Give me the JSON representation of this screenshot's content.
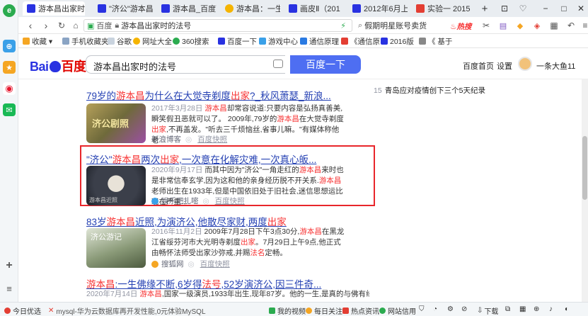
{
  "colors": {
    "accent": "#4e6ef2",
    "link": "#2440b3",
    "highlight": "#f73131",
    "frame": "#e8262b"
  },
  "tabs": [
    {
      "label": "游本昌出家时",
      "active": true
    },
    {
      "label": "\"济公\"游本昌"
    },
    {
      "label": "游本昌_百度百"
    },
    {
      "label": "游本昌：一生"
    },
    {
      "label": "画皮Ⅱ（201"
    },
    {
      "label": "2012年6月上"
    },
    {
      "label": "实验一 2015"
    }
  ],
  "window": {
    "new_tab": "+",
    "minimize": "−",
    "maximize": "□",
    "close": "✕"
  },
  "address": {
    "secure_label": "百度",
    "url": "游本昌出家时的法号",
    "search_hint": "假期明星账号卖货",
    "hot_tag": "热搜"
  },
  "bookmarks": [
    {
      "label": "收藏 ▾"
    },
    {
      "label": "手机收藏夹"
    },
    {
      "label": "谷歌"
    },
    {
      "label": "网址大全"
    },
    {
      "label": "360搜索"
    },
    {
      "label": "百度一下"
    },
    {
      "label": "游戏中心"
    },
    {
      "label": "通信原理"
    },
    {
      "label": "《通信原"
    },
    {
      "label": "2016版"
    },
    {
      "label": "《 基于"
    }
  ],
  "baidu": {
    "logo_left": "Bai",
    "logo_right": "百度",
    "query": "游本昌出家时的法号",
    "search_button": "百度一下",
    "links": [
      "百度首页",
      "设置"
    ],
    "username": "一条大鱼11"
  },
  "results": [
    {
      "title_parts": [
        [
          "79岁的",
          ""
        ],
        [
          "游本昌",
          "hl"
        ],
        [
          "为什么在大觉寺剃度",
          ""
        ],
        [
          "出家",
          "hl"
        ],
        [
          "?_秋风萧瑟_新浪...",
          ""
        ]
      ],
      "date": "2017年3月28日",
      "snippet_parts": [
        [
          "游本昌",
          "hl"
        ],
        [
          "却常容说道:只要内容是弘扬真善美,瞬笑假丑恶就可以了。 2009年,79岁的",
          ""
        ],
        [
          "游本昌",
          "hl"
        ],
        [
          "在大觉寺剃度",
          ""
        ],
        [
          "出家",
          "hl"
        ],
        [
          ",不再盖发。\"听去三千烦恼丝,省事儿嘛。\"有媒体称他老...",
          ""
        ]
      ],
      "source": "新浪博客",
      "cache": "百度快照"
    },
    {
      "title_parts": [
        [
          "\"济公\"",
          ""
        ],
        [
          "游本昌",
          "hl"
        ],
        [
          "两次",
          ""
        ],
        [
          "出家",
          "hl"
        ],
        [
          ",一次意在化解灾难,一次真心皈...",
          ""
        ]
      ],
      "date": "2020年9月17日",
      "snippet_parts": [
        [
          "而其中因为\"济公\"一角走红的",
          ""
        ],
        [
          "游本昌",
          "hl"
        ],
        [
          "来时也是非常信奉玄学,因为这和他的亲身经历脱不开关系.",
          ""
        ],
        [
          "游本昌",
          "hl"
        ],
        [
          "老师出生在1933年,但是中国依旧处于旧社会,迷信思想运比现在严重...",
          ""
        ]
      ],
      "source": "娱乐吧扎嘧",
      "cache": "百度快照"
    },
    {
      "title_parts": [
        [
          "83岁",
          ""
        ],
        [
          "游本昌",
          "hl"
        ],
        [
          "近照,为演济公,他散尽家财,两度",
          ""
        ],
        [
          "出家",
          "hl"
        ]
      ],
      "date": "2016年11月2日",
      "snippet_parts": [
        [
          "2009年7月28日下午3点30分,",
          ""
        ],
        [
          "游本昌",
          "hl"
        ],
        [
          "在黑龙江省绥芬河市大光明寺剃度",
          ""
        ],
        [
          "出家",
          "hl"
        ],
        [
          "。7月29日上午9点,他正式由畅怀法师受出家沙弥戒,并赐",
          ""
        ],
        [
          "法名",
          "hl"
        ],
        [
          "定畅。",
          ""
        ]
      ],
      "source": "搜狐网",
      "cache": "百度快照"
    },
    {
      "title_parts": [
        [
          "游本昌",
          "hl"
        ],
        [
          ":一生佛缘不断,6岁得",
          ""
        ],
        [
          "法号",
          "hl"
        ],
        [
          ",52岁演济公,因三件奇...",
          ""
        ]
      ],
      "date": "2020年7月14日",
      "snippet_parts": [
        [
          "游本昌",
          "hl"
        ],
        [
          ",国家一级演员,1933年出生,现年87岁。他的一生,是真的与佛有缘,而且\"缘",
          ""
        ]
      ]
    }
  ],
  "thumbnails": [
    "济公剧照",
    "游本昌近照",
    "济公游记"
  ],
  "hot": {
    "num": "15",
    "text": "青岛应对疫情创下三个5天纪录"
  },
  "statusbar": {
    "left": "今日优选",
    "ticker": "mysql-华为云数据库再开发性能,0元体验MySQL",
    "items": [
      "我的视频",
      "每日关注",
      "热点资讯",
      "网站信用",
      "下载"
    ]
  }
}
